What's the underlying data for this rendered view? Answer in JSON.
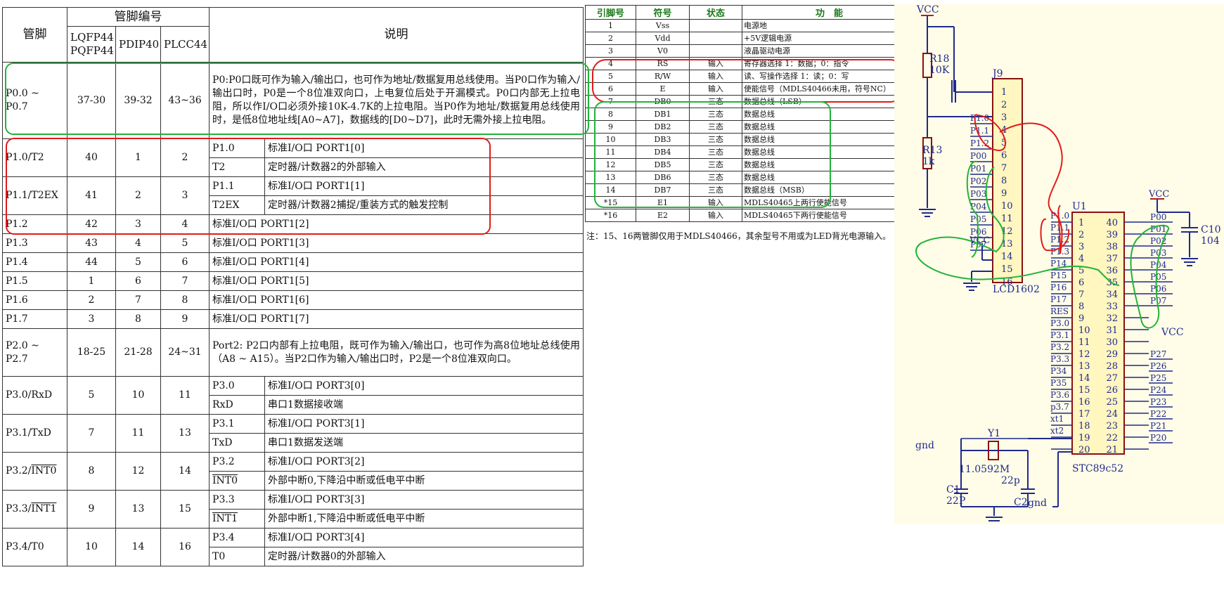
{
  "pin_table": {
    "header": {
      "pin": "管脚",
      "pin_number_group": "管脚编号",
      "pkg1": "LQFP44 PQFP44",
      "pkg2": "PDIP40",
      "pkg3": "PLCC44",
      "desc": "说明"
    },
    "p0": {
      "name": "P0.0 ~ P0.7",
      "lqfp": "37-30",
      "pdip": "39-32",
      "plcc": "43~36",
      "desc": "P0:P0口既可作为输入/输出口，也可作为地址/数据复用总线使用。当P0口作为输入/输出口时，P0是一个8位准双向口，上电复位后处于开漏模式。P0口内部无上拉电阻，所以作I/O口必须外接10K-4.7K的上拉电阻。当P0作为地址/数据复用总线使用时，是低8位地址线[A0~A7]，数据线的[D0~D7]，此时无需外接上拉电阻。"
    },
    "p10": {
      "name": "P1.0/T2",
      "lqfp": "40",
      "pdip": "1",
      "plcc": "2",
      "f1": "P1.0",
      "d1": "标准I/O口  PORT1[0]",
      "f2": "T2",
      "d2": "定时器/计数器2的外部输入"
    },
    "p11": {
      "name": "P1.1/T2EX",
      "lqfp": "41",
      "pdip": "2",
      "plcc": "3",
      "f1": "P1.1",
      "d1": "标准I/O口  PORT1[1]",
      "f2": "T2EX",
      "d2": "定时器/计数器2捕捉/重装方式的触发控制"
    },
    "p12": {
      "name": "P1.2",
      "lqfp": "42",
      "pdip": "3",
      "plcc": "4",
      "desc": "标准I/O口  PORT1[2]"
    },
    "p13": {
      "name": "P1.3",
      "lqfp": "43",
      "pdip": "4",
      "plcc": "5",
      "desc": "标准I/O口  PORT1[3]"
    },
    "p14": {
      "name": "P1.4",
      "lqfp": "44",
      "pdip": "5",
      "plcc": "6",
      "desc": "标准I/O口  PORT1[4]"
    },
    "p15": {
      "name": "P1.5",
      "lqfp": "1",
      "pdip": "6",
      "plcc": "7",
      "desc": "标准I/O口  PORT1[5]"
    },
    "p16": {
      "name": "P1.6",
      "lqfp": "2",
      "pdip": "7",
      "plcc": "8",
      "desc": "标准I/O口  PORT1[6]"
    },
    "p17": {
      "name": "P1.7",
      "lqfp": "3",
      "pdip": "8",
      "plcc": "9",
      "desc": "标准I/O口  PORT1[7]"
    },
    "p2": {
      "name": "P2.0 ~ P2.7",
      "lqfp": "18-25",
      "pdip": "21-28",
      "plcc": "24~31",
      "desc": "Port2: P2口内部有上拉电阻，既可作为输入/输出口，也可作为高8位地址总线使用（A8 ~ A15）。当P2口作为输入/输出口时，P2是一个8位准双向口。"
    },
    "p30": {
      "name": "P3.0/RxD",
      "lqfp": "5",
      "pdip": "10",
      "plcc": "11",
      "f1": "P3.0",
      "d1": "标准I/O口  PORT3[0]",
      "f2": "RxD",
      "d2": "串口1数据接收端"
    },
    "p31": {
      "name": "P3.1/TxD",
      "lqfp": "7",
      "pdip": "11",
      "plcc": "13",
      "f1": "P3.1",
      "d1": "标准I/O口  PORT3[1]",
      "f2": "TxD",
      "d2": "串口1数据发送端"
    },
    "p32": {
      "name_a": "P3.2/",
      "name_b": "INT0",
      "lqfp": "8",
      "pdip": "12",
      "plcc": "14",
      "f1": "P3.2",
      "d1": "标准I/O口  PORT3[2]",
      "f2": "INT0",
      "d2": "外部中断0,下降沿中断或低电平中断"
    },
    "p33": {
      "name_a": "P3.3/",
      "name_b": "INT1",
      "lqfp": "9",
      "pdip": "13",
      "plcc": "15",
      "f1": "P3.3",
      "d1": "标准I/O口  PORT3[3]",
      "f2": "INT1",
      "d2": "外部中断1,下降沿中断或低电平中断"
    },
    "p34": {
      "name": "P3.4/T0",
      "lqfp": "10",
      "pdip": "14",
      "plcc": "16",
      "f1": "P3.4",
      "d1": "标准I/O口  PORT3[4]",
      "f2": "T0",
      "d2": "定时器/计数器0的外部输入"
    }
  },
  "lcd_table": {
    "headers": [
      "引脚号",
      "符号",
      "状态",
      "功　能"
    ],
    "rows": [
      [
        "1",
        "Vss",
        "",
        "电源地"
      ],
      [
        "2",
        "Vdd",
        "",
        "+5V逻辑电源"
      ],
      [
        "3",
        "V0",
        "",
        "液晶驱动电源"
      ],
      [
        "4",
        "RS",
        "输入",
        "寄存器选择 1：数据；0：指令"
      ],
      [
        "5",
        "R/W",
        "输入",
        "读、写操作选择 1：读；0：写"
      ],
      [
        "6",
        "E",
        "输入",
        "使能信号（MDLS40466未用，符号NC）"
      ],
      [
        "7",
        "DB0",
        "三态",
        "数据总线（LSB）"
      ],
      [
        "8",
        "DB1",
        "三态",
        "数据总线"
      ],
      [
        "9",
        "DB2",
        "三态",
        "数据总线"
      ],
      [
        "10",
        "DB3",
        "三态",
        "数据总线"
      ],
      [
        "11",
        "DB4",
        "三态",
        "数据总线"
      ],
      [
        "12",
        "DB5",
        "三态",
        "数据总线"
      ],
      [
        "13",
        "DB6",
        "三态",
        "数据总线"
      ],
      [
        "14",
        "DB7",
        "三态",
        "数据总线（MSB）"
      ],
      [
        "*15",
        "E1",
        "输入",
        "MDLS40465上两行使能信号"
      ],
      [
        "*16",
        "E2",
        "输入",
        "MDLS40465下两行使能信号"
      ]
    ],
    "note": "注：15、16两管脚仅用于MDLS40466，其余型号不用或为LED背光电源输入。"
  },
  "schematic": {
    "vcc": "VCC",
    "gnd": "gnd",
    "r18": "R18",
    "r18_val": "10K",
    "r13": "R13",
    "r13_val": "1k",
    "j9": "J9",
    "lcd_name": "LCD1602",
    "u1": "U1",
    "mcu_name": "STC89c52",
    "c10": "C10",
    "c10_val": "104",
    "y1": "Y1",
    "y1_val": "11.0592M",
    "c1": "C1",
    "c1_val": "22P",
    "c2": "C2",
    "c2_val": "22p",
    "xt1": "xt1",
    "xt2": "xt2",
    "j9_pins": [
      "1",
      "2",
      "3",
      "4",
      "5",
      "6",
      "7",
      "8",
      "9",
      "10",
      "11",
      "12",
      "13",
      "14",
      "15",
      "16"
    ],
    "j9_labels": [
      "P1.0",
      "P1.1",
      "P1.2",
      "P00",
      "P01",
      "P02",
      "P03",
      "P04",
      "P05",
      "P06",
      "P07"
    ],
    "u1_left_pins": [
      "1",
      "2",
      "3",
      "4",
      "5",
      "6",
      "7",
      "8",
      "9",
      "10",
      "11",
      "12",
      "13",
      "14",
      "15",
      "16",
      "17",
      "18",
      "19",
      "20"
    ],
    "u1_left_labels": [
      "P1.0",
      "P1.1",
      "P1.2",
      "P1.3",
      "P14",
      "P15",
      "P16",
      "P17",
      "RES",
      "P3.0",
      "P3.1",
      "P3.2",
      "P3.3",
      "P34",
      "P35",
      "P3.6",
      "p3.7",
      "xt1",
      "xt2"
    ],
    "u1_right_pins": [
      "40",
      "39",
      "38",
      "37",
      "36",
      "35",
      "34",
      "33",
      "32",
      "31",
      "30",
      "29",
      "28",
      "27",
      "26",
      "25",
      "24",
      "23",
      "22",
      "21"
    ],
    "u1_right_labels": [
      "P00",
      "P01",
      "P02",
      "P03",
      "P04",
      "P05",
      "P06",
      "P07",
      "VCC",
      "P27",
      "P26",
      "P25",
      "P24",
      "P23",
      "P22",
      "P21",
      "P20"
    ]
  }
}
